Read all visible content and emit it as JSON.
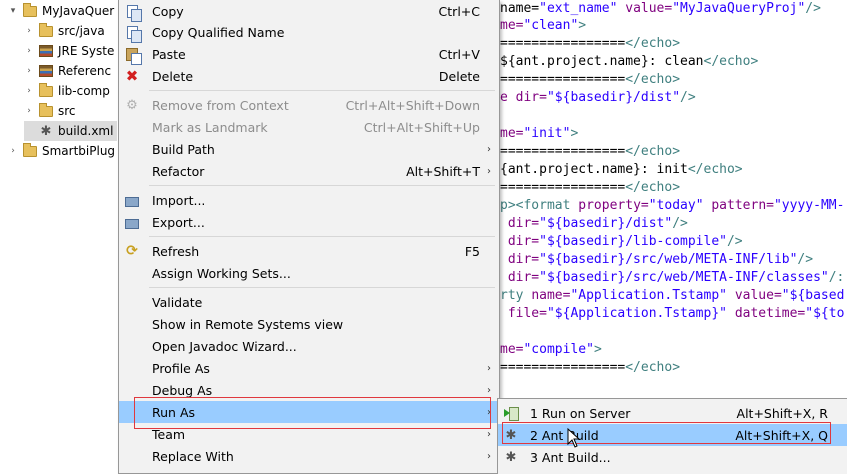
{
  "tree": {
    "items": [
      {
        "twisty": "▾",
        "icon": "project-icon",
        "label": "MyJavaQuer"
      },
      {
        "twisty": "›",
        "icon": "folder-icon",
        "label": "src/java"
      },
      {
        "twisty": "›",
        "icon": "library-icon",
        "label": "JRE Syste"
      },
      {
        "twisty": "›",
        "icon": "library-icon",
        "label": "Referenc"
      },
      {
        "twisty": "›",
        "icon": "folder-icon",
        "label": "lib-comp"
      },
      {
        "twisty": "›",
        "icon": "folder-icon",
        "label": "src"
      },
      {
        "twisty": "",
        "icon": "ant-file-icon",
        "label": "build.xml"
      },
      {
        "twisty": "›",
        "icon": "project-icon",
        "label": "SmartbiPlug"
      }
    ]
  },
  "editor": {
    "lines": [
      {
        "parts": [
          [
            "txt",
            "name="
          ],
          [
            "val",
            "\"ext_name\""
          ],
          [
            "txt",
            " "
          ],
          [
            "attr",
            "value="
          ],
          [
            "val",
            "\"MyJavaQueryProj\""
          ],
          [
            "tag",
            "/>"
          ]
        ]
      },
      {
        "parts": [
          [
            "attr",
            "me="
          ],
          [
            "val",
            "\"clean\""
          ],
          [
            "tag",
            ">"
          ]
        ]
      },
      {
        "parts": [
          [
            "txt",
            "================"
          ],
          [
            "tag",
            "</echo>"
          ]
        ]
      },
      {
        "parts": [
          [
            "txt",
            "${ant.project.name}: clean"
          ],
          [
            "tag",
            "</echo>"
          ]
        ]
      },
      {
        "parts": [
          [
            "txt",
            "================"
          ],
          [
            "tag",
            "</echo>"
          ]
        ]
      },
      {
        "parts": [
          [
            "attr",
            "e dir="
          ],
          [
            "val",
            "\"${basedir}/dist\""
          ],
          [
            "tag",
            "/>"
          ]
        ]
      },
      {
        "parts": [
          [
            "txt",
            ""
          ]
        ]
      },
      {
        "parts": [
          [
            "attr",
            "me="
          ],
          [
            "val",
            "\"init\""
          ],
          [
            "tag",
            ">"
          ]
        ]
      },
      {
        "parts": [
          [
            "txt",
            "================"
          ],
          [
            "tag",
            "</echo>"
          ]
        ]
      },
      {
        "parts": [
          [
            "txt",
            "{ant.project.name}: init"
          ],
          [
            "tag",
            "</echo>"
          ]
        ]
      },
      {
        "parts": [
          [
            "txt",
            "================"
          ],
          [
            "tag",
            "</echo>"
          ]
        ]
      },
      {
        "parts": [
          [
            "tag",
            "p><format "
          ],
          [
            "attr",
            "property="
          ],
          [
            "val",
            "\"today\""
          ],
          [
            "txt",
            " "
          ],
          [
            "attr",
            "pattern="
          ],
          [
            "val",
            "\"yyyy-MM-"
          ]
        ]
      },
      {
        "parts": [
          [
            "attr",
            " dir="
          ],
          [
            "val",
            "\"${basedir}/dist\""
          ],
          [
            "tag",
            "/>"
          ]
        ]
      },
      {
        "parts": [
          [
            "attr",
            " dir="
          ],
          [
            "val",
            "\"${basedir}/lib-compile\""
          ],
          [
            "tag",
            "/>"
          ]
        ]
      },
      {
        "parts": [
          [
            "attr",
            " dir="
          ],
          [
            "val",
            "\"${basedir}/src/web/META-INF/lib\""
          ],
          [
            "tag",
            "/>"
          ]
        ]
      },
      {
        "parts": [
          [
            "attr",
            " dir="
          ],
          [
            "val",
            "\"${basedir}/src/web/META-INF/classes\""
          ],
          [
            "tag",
            "/:"
          ]
        ]
      },
      {
        "parts": [
          [
            "tag",
            "rty "
          ],
          [
            "attr",
            "name="
          ],
          [
            "val",
            "\"Application.Tstamp\""
          ],
          [
            "txt",
            " "
          ],
          [
            "attr",
            "value="
          ],
          [
            "val",
            "\"${based"
          ]
        ]
      },
      {
        "parts": [
          [
            "attr",
            " file="
          ],
          [
            "val",
            "\"${Application.Tstamp}\""
          ],
          [
            "txt",
            " "
          ],
          [
            "attr",
            "datetime="
          ],
          [
            "val",
            "\"${to"
          ]
        ]
      },
      {
        "parts": [
          [
            "txt",
            ""
          ]
        ]
      },
      {
        "parts": [
          [
            "attr",
            "me="
          ],
          [
            "val",
            "\"compile\""
          ],
          [
            "tag",
            ">"
          ]
        ]
      },
      {
        "parts": [
          [
            "txt",
            "================"
          ],
          [
            "tag",
            "</echo>"
          ]
        ]
      }
    ]
  },
  "context_menu": {
    "items": [
      {
        "id": "copy",
        "label": "Copy",
        "accel": "Ctrl+C",
        "icon": "copy-icon"
      },
      {
        "id": "copy-qualified-name",
        "label": "Copy Qualified Name",
        "accel": "",
        "icon": "copy-icon"
      },
      {
        "id": "paste",
        "label": "Paste",
        "accel": "Ctrl+V",
        "icon": "paste-icon"
      },
      {
        "id": "delete",
        "label": "Delete",
        "accel": "Delete",
        "icon": "delete-icon"
      },
      {
        "sep": true
      },
      {
        "id": "remove-from-context",
        "label": "Remove from Context",
        "accel": "Ctrl+Alt+Shift+Down",
        "icon": "context-icon",
        "disabled": true
      },
      {
        "id": "mark-as-landmark",
        "label": "Mark as Landmark",
        "accel": "Ctrl+Alt+Shift+Up",
        "icon": "",
        "disabled": true
      },
      {
        "id": "build-path",
        "label": "Build Path",
        "accel": "",
        "icon": "",
        "submenu": true
      },
      {
        "id": "refactor",
        "label": "Refactor",
        "accel": "Alt+Shift+T",
        "icon": "",
        "submenu": true
      },
      {
        "sep": true
      },
      {
        "id": "import",
        "label": "Import...",
        "accel": "",
        "icon": "import-icon"
      },
      {
        "id": "export",
        "label": "Export...",
        "accel": "",
        "icon": "export-icon"
      },
      {
        "sep": true
      },
      {
        "id": "refresh",
        "label": "Refresh",
        "accel": "F5",
        "icon": "refresh-icon"
      },
      {
        "id": "assign-working-sets",
        "label": "Assign Working Sets...",
        "accel": "",
        "icon": ""
      },
      {
        "sep": true
      },
      {
        "id": "validate",
        "label": "Validate",
        "accel": "",
        "icon": ""
      },
      {
        "id": "show-in-remote-systems-view",
        "label": "Show in Remote Systems view",
        "accel": "",
        "icon": ""
      },
      {
        "id": "open-javadoc-wizard",
        "label": "Open Javadoc Wizard...",
        "accel": "",
        "icon": ""
      },
      {
        "id": "profile-as",
        "label": "Profile As",
        "accel": "",
        "icon": "",
        "submenu": true
      },
      {
        "id": "debug-as",
        "label": "Debug As",
        "accel": "",
        "icon": "",
        "submenu": true
      },
      {
        "id": "run-as",
        "label": "Run As",
        "accel": "",
        "icon": "",
        "submenu": true,
        "highlight": true
      },
      {
        "id": "team",
        "label": "Team",
        "accel": "",
        "icon": "",
        "submenu": true
      },
      {
        "id": "replace-with",
        "label": "Replace With",
        "accel": "",
        "icon": "",
        "submenu": true
      }
    ]
  },
  "submenu": {
    "items": [
      {
        "id": "run-on-server",
        "label": "1 Run on Server",
        "accel": "Alt+Shift+X, R",
        "icon": "run-server-icon"
      },
      {
        "id": "ant-build",
        "label": "2 Ant Build",
        "accel": "Alt+Shift+X, Q",
        "icon": "ant-icon",
        "highlight": true
      },
      {
        "id": "ant-build-dialog",
        "label": "3 Ant Build...",
        "accel": "",
        "icon": "ant-icon"
      }
    ]
  },
  "colors": {
    "highlight": "#99ccff",
    "menu_bg": "#f2f2f2",
    "annotation_red": "#e0383e"
  }
}
